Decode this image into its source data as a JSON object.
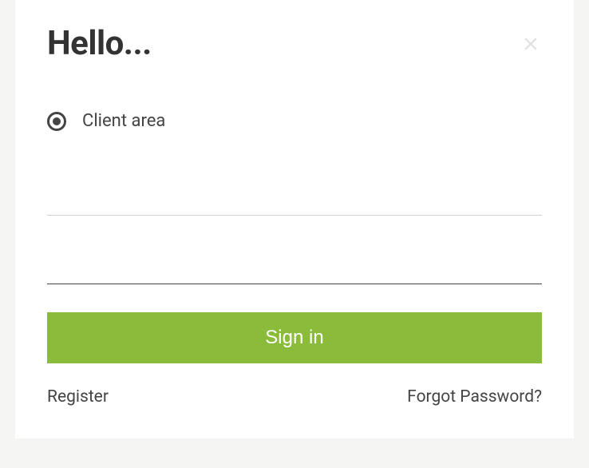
{
  "modal": {
    "title": "Hello...",
    "radio": {
      "label": "Client area",
      "selected": true
    },
    "form": {
      "username_value": "",
      "password_value": "",
      "signin_label": "Sign in"
    },
    "footer": {
      "register_label": "Register",
      "forgot_label": "Forgot Password?"
    }
  },
  "colors": {
    "primary": "#8bbb3b",
    "text": "#444",
    "close": "#e0e0e0"
  }
}
